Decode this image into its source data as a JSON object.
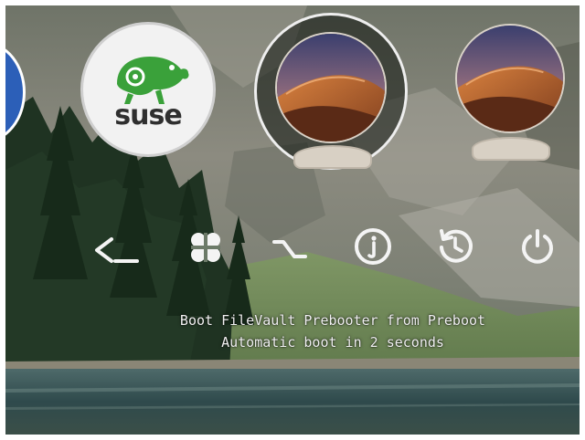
{
  "screen": {
    "boot_entries": [
      {
        "id": "partial-blue-entry",
        "icon": "blue-disk-icon",
        "selected": false
      },
      {
        "id": "suse",
        "icon": "suse-chameleon-icon",
        "label": "suse",
        "selected": false
      },
      {
        "id": "macos-mojave-selected",
        "icon": "macos-mojave-icon",
        "selected": true
      },
      {
        "id": "macos-mojave",
        "icon": "macos-mojave-icon",
        "selected": false
      }
    ],
    "tools": [
      {
        "id": "shell",
        "icon": "shell-prompt-icon",
        "glyph": "<_"
      },
      {
        "id": "mac-key",
        "icon": "command-key-icon"
      },
      {
        "id": "option",
        "icon": "option-key-icon"
      },
      {
        "id": "about",
        "icon": "info-icon"
      },
      {
        "id": "reset",
        "icon": "reset-nvram-icon"
      },
      {
        "id": "shutdown",
        "icon": "power-icon"
      }
    ],
    "status": {
      "line1": "Boot FileVault Prebooter from Preboot",
      "line2": "Automatic boot in 2 seconds"
    },
    "colors": {
      "text": "#f2f2f2",
      "suse_green": "#3aa13a",
      "selection_ring": "#eeeeee"
    }
  }
}
